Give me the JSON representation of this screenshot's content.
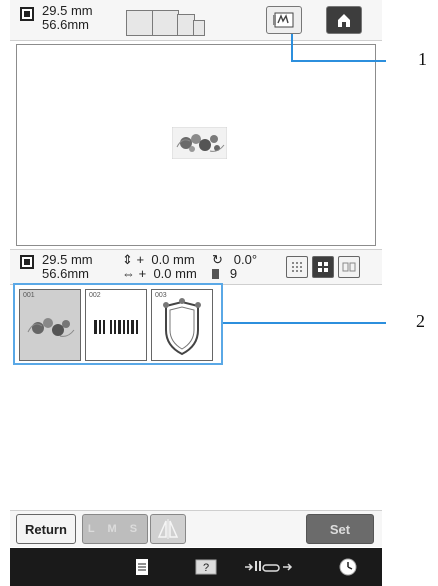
{
  "top": {
    "width_value": "29.5",
    "height_value": "56.6",
    "unit": "mm",
    "edit_icon": "embroidery-edit-icon",
    "home_icon": "home-icon"
  },
  "info": {
    "width_value": "29.5",
    "height_value": "56.6",
    "vmove_value": "0.0",
    "hmove_value": "0.0",
    "unit": "mm",
    "angle_value": "0.0°",
    "color_count": "9"
  },
  "thumbnails": [
    {
      "number": "001",
      "label": "floral"
    },
    {
      "number": "002",
      "label": "barcode"
    },
    {
      "number": "003",
      "label": "crest"
    }
  ],
  "bottom": {
    "return_label": "Return",
    "lms_label": "L M S",
    "set_label": "Set"
  },
  "callouts": {
    "one": "1",
    "two": "2"
  },
  "colors": {
    "callout": "#2c8fdd",
    "selected_bg": "#cfcfcf",
    "dark_button": "#3d3d3d"
  }
}
